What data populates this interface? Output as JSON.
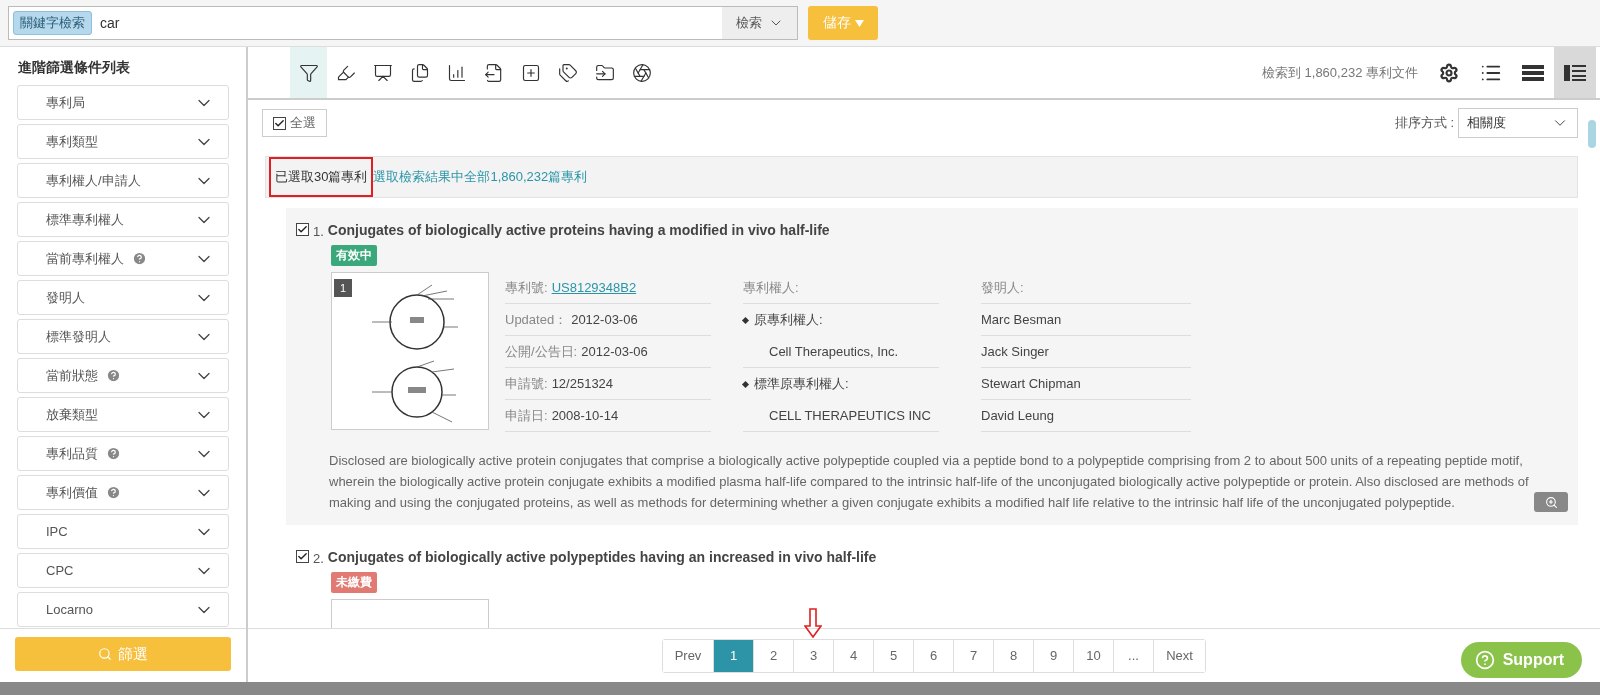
{
  "search": {
    "tag": "關鍵字檢索",
    "value": "car",
    "button": "檢索",
    "save": "儲存"
  },
  "sidebar": {
    "title": "進階篩選條件列表",
    "filters": [
      {
        "label": "專利局",
        "help": false
      },
      {
        "label": "專利類型",
        "help": false
      },
      {
        "label": "專利權人/申請人",
        "help": false
      },
      {
        "label": "標準專利權人",
        "help": false
      },
      {
        "label": "當前專利權人",
        "help": true
      },
      {
        "label": "發明人",
        "help": false
      },
      {
        "label": "標準發明人",
        "help": false
      },
      {
        "label": "當前狀態",
        "help": true
      },
      {
        "label": "放棄類型",
        "help": false
      },
      {
        "label": "專利品質",
        "help": true
      },
      {
        "label": "專利價值",
        "help": true
      },
      {
        "label": "IPC",
        "help": false
      },
      {
        "label": "CPC",
        "help": false
      },
      {
        "label": "Locarno",
        "help": false
      }
    ],
    "filter_button": "篩選"
  },
  "toolbar": {
    "tools": [
      {
        "kind": "filter",
        "selected": true
      },
      {
        "kind": "marker",
        "selected": false
      },
      {
        "kind": "monitor",
        "selected": false
      },
      {
        "kind": "documents",
        "selected": false
      },
      {
        "kind": "chart",
        "selected": false
      },
      {
        "kind": "export",
        "selected": false
      },
      {
        "kind": "add",
        "selected": false
      },
      {
        "kind": "tags",
        "selected": false
      },
      {
        "kind": "folder",
        "selected": false
      },
      {
        "kind": "circle",
        "selected": false
      }
    ],
    "result_count": "檢索到 1,860,232 專利文件",
    "views": [
      {
        "kind": "settings",
        "selected": false
      },
      {
        "kind": "list",
        "selected": false
      },
      {
        "kind": "rows",
        "selected": false
      },
      {
        "kind": "detail",
        "selected": true
      }
    ]
  },
  "select_all": {
    "label": "全選",
    "checked": true
  },
  "sort": {
    "label": "排序方式 :",
    "value": "相關度"
  },
  "selection": {
    "text": "已選取30篇專利",
    "link": "選取檢索結果中全部1,860,232篇專利",
    "highlighted": true
  },
  "results": [
    {
      "number": "1.",
      "checked": true,
      "title": "Conjugates of biologically active proteins having a modified in vivo half-life",
      "status": "有效中",
      "color": "#3aa87b",
      "image_index": "1",
      "fields": [
        {
          "label": "專利號:",
          "value": "US8129348B2",
          "kind": "link"
        },
        {
          "label": "Updated：",
          "value": "2012-03-06",
          "kind": "text"
        },
        {
          "label": "公開/公告日:",
          "value": "2012-03-06",
          "kind": "text"
        },
        {
          "label": "申請號:",
          "value": "12/251324",
          "kind": "text"
        },
        {
          "label": "申請日:",
          "value": "2008-10-14",
          "kind": "text"
        }
      ],
      "owners": {
        "heading": "專利權人:",
        "groups": [
          {
            "label": "原專利權人:",
            "name": "Cell Therapeutics, Inc."
          },
          {
            "label": "標準原專利權人:",
            "name": "CELL THERAPEUTICS INC"
          }
        ]
      },
      "inventors": {
        "heading": "發明人:",
        "names": [
          "Marc Besman",
          "Jack Singer",
          "Stewart Chipman",
          "David Leung"
        ]
      },
      "abstract": "Disclosed are biologically active protein conjugates that comprise a biologically active polypeptide coupled via a peptide bond to a polypeptide comprising from 2 to about 500 units of a repeating peptide motif, wherein the biologically active protein conjugate exhibits a modified plasma half-life compared to the intrinsic half-life of the unconjugated biologically active polypeptide or protein. Also disclosed are methods of making and using the conjugated proteins, as well as methods for determining whether a given conjugate exhibits a modified half life relative to the intrinsic half life of the unconjugated polypeptide."
    },
    {
      "number": "2.",
      "checked": true,
      "title": "Conjugates of biologically active polypeptides having an increased in vivo half-life",
      "status": "未繳費",
      "color": "#e07a72"
    }
  ],
  "pagination": {
    "prev": "Prev",
    "pages": [
      {
        "label": "1",
        "selected": true,
        "marked": false
      },
      {
        "label": "2",
        "selected": false,
        "marked": false
      },
      {
        "label": "3",
        "selected": false,
        "marked": true
      },
      {
        "label": "4",
        "selected": false,
        "marked": false
      },
      {
        "label": "5",
        "selected": false,
        "marked": false
      },
      {
        "label": "6",
        "selected": false,
        "marked": false
      },
      {
        "label": "7",
        "selected": false,
        "marked": false
      },
      {
        "label": "8",
        "selected": false,
        "marked": false
      },
      {
        "label": "9",
        "selected": false,
        "marked": false
      },
      {
        "label": "10",
        "selected": false,
        "marked": false
      },
      {
        "label": "...",
        "selected": false,
        "marked": false
      }
    ],
    "next": "Next"
  },
  "support": "Support"
}
